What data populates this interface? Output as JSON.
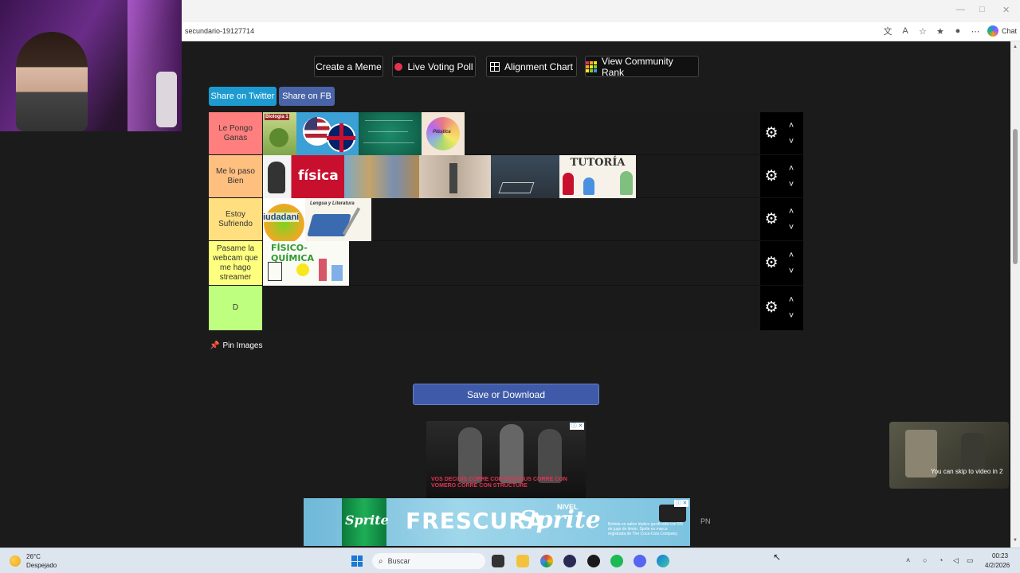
{
  "browser": {
    "url": "secundario-19127714",
    "chat_label": "Chat",
    "minimize": "—",
    "maximize": "□",
    "close": "✕"
  },
  "toolbar": {
    "create_meme": "Create a Meme",
    "live_voting": "Live Voting Poll",
    "alignment_chart": "Alignment Chart",
    "community_rank": "View Community Rank"
  },
  "share": {
    "twitter": "Share on Twitter",
    "facebook": "Share on FB"
  },
  "tiers": [
    {
      "label": "Le Pongo Ganas",
      "color": "#ff7f7f"
    },
    {
      "label": "Me lo paso Bien",
      "color": "#ffbf7f"
    },
    {
      "label": "Estoy Sufriendo",
      "color": "#ffdf7f"
    },
    {
      "label": "Pasame la webcam que me hago streamer",
      "color": "#ffff7f"
    },
    {
      "label": "D",
      "color": "#bfff7f"
    }
  ],
  "images": {
    "biologia": "Biología 1",
    "fisica": "física",
    "tutoria": "TUTORÍA",
    "ciudadania": "iudadaní",
    "lengua": "Lengua y Literatura",
    "fisicoquimica": "FÍSICO-QUÍMICA",
    "plastica": "Plástica"
  },
  "pin_images": "Pin Images",
  "save_download": "Save or Download",
  "ads": {
    "mid_text": "VOS DECIDÍS CORRE CON PEGASUS CORRE CON VOMERO CORRE CON STRUCTURE",
    "bottom_brand": "FRESCURA",
    "bottom_logo": "Sprite",
    "bottom_nivel": "NIVEL",
    "bottom_fine": "Bebida en sabor léptico gasificada con 5% de jugo de limón. Sprite es marca registrada de The Coca-Cola Company.",
    "pn": "PN",
    "video_skip": "You can skip to video in 2"
  },
  "taskbar": {
    "temp": "26°C",
    "weather": "Despejado",
    "search": "Buscar",
    "time": "00:23",
    "date": "4/2/2026"
  }
}
